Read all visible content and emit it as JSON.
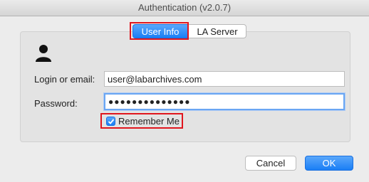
{
  "window": {
    "title": "Authentication (v2.0.7)"
  },
  "tabs": [
    {
      "label": "User Info",
      "selected": true
    },
    {
      "label": "LA Server",
      "selected": false
    }
  ],
  "form": {
    "login_label": "Login or email:",
    "login_value": "user@labarchives.com",
    "password_label": "Password:",
    "password_mask": "●●●●●●●●●●●●●●",
    "remember_label": "Remember Me",
    "remember_checked": true
  },
  "buttons": {
    "cancel": "Cancel",
    "ok": "OK"
  },
  "icons": {
    "user": "user-icon",
    "check": "checkmark-icon"
  },
  "colors": {
    "accent": "#1a7ef5",
    "highlight": "#e0161e"
  }
}
